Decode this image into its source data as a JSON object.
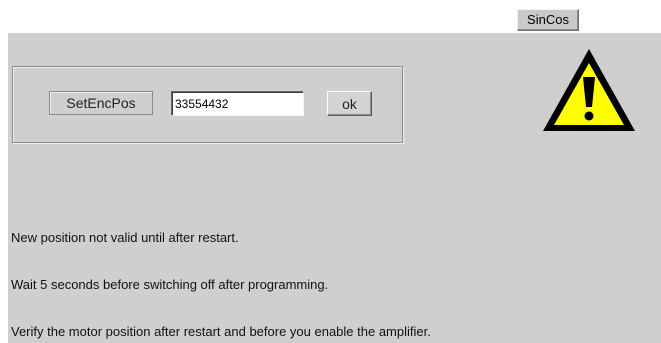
{
  "header": {
    "tab_label": "SinCos"
  },
  "encoder": {
    "label": "SetEncPos",
    "position_value": "33554432",
    "ok_label": "ok"
  },
  "warning": {
    "icon": "warning-triangle-icon",
    "fill_color": "#ffff00",
    "stroke_color": "#000000"
  },
  "messages": [
    "New position not valid until after restart.",
    "Wait 5 seconds before switching off after programming.",
    "Verify the motor position after restart and before you enable the amplifier."
  ]
}
